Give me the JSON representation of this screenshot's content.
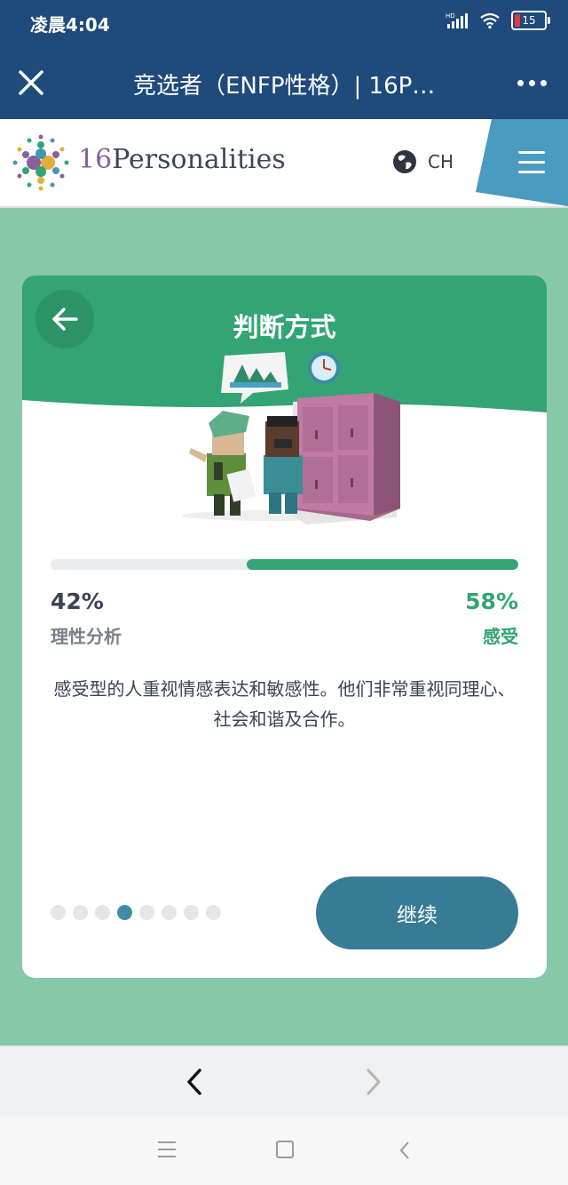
{
  "status_bar": {
    "time": "凌晨4:04",
    "network": "HD",
    "battery": "15"
  },
  "app_bar": {
    "title": "竞选者（ENFP性格）| 16P…"
  },
  "site_header": {
    "brand_number": "16",
    "brand_name": "Personalities",
    "language": "CH"
  },
  "card": {
    "title": "判断方式",
    "left_percent": "42%",
    "left_trait": "理性分析",
    "right_percent": "58%",
    "right_trait": "感受",
    "dominant_fraction": 0.58,
    "description": "感受型的人重视情感表达和敏感性。他们非常重视同理心、社会和谐及合作。",
    "pagination": {
      "total": 8,
      "current": 4
    },
    "continue_label": "继续"
  },
  "colors": {
    "header": "#1f4a7c",
    "accent_green": "#33a474",
    "page_bg": "#86c8a7",
    "button": "#387b94"
  }
}
